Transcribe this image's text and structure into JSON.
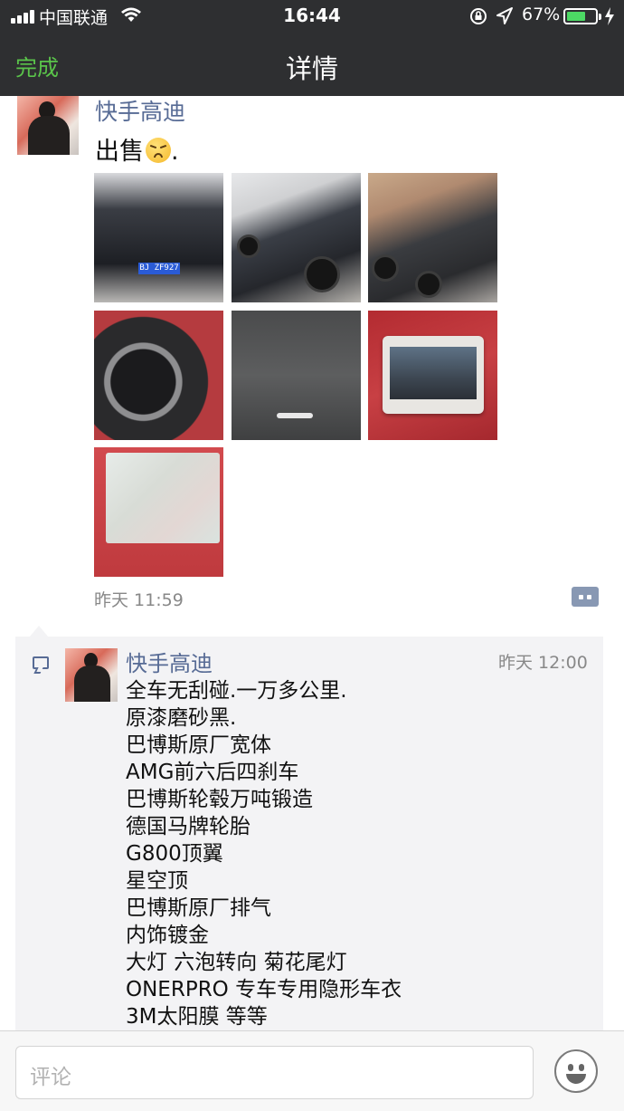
{
  "status_bar": {
    "carrier": "中国联通",
    "time": "16:44",
    "battery_percent": "67%",
    "battery_level": 0.67
  },
  "nav": {
    "done_label": "完成",
    "title": "详情"
  },
  "post": {
    "author": "快手高迪",
    "text": "出售",
    "emoji": "sleepy-face-emoji",
    "text_suffix": ".",
    "photos": [
      "car-front-photo",
      "car-side-photo",
      "car-rear-side-photo",
      "steering-wheel-photo",
      "interior-light-photo",
      "car-photo-card",
      "vehicle-license-photo"
    ],
    "plate": "BJ ZF927",
    "time": "昨天 11:59"
  },
  "comment": {
    "author": "快手高迪",
    "time": "昨天 12:00",
    "lines": [
      "全车无刮碰.一万多公里.",
      "原漆磨砂黑.",
      "巴博斯原厂宽体",
      "AMG前六后四刹车",
      "巴博斯轮毂万吨锻造",
      "德国马牌轮胎",
      "G800顶翼",
      "星空顶",
      "巴博斯原厂排气",
      "内饰镀金",
      "大灯 六泡转向 菊花尾灯",
      "ONERPRO 专车专用隐形车衣",
      "3M太阳膜 等等"
    ]
  },
  "input": {
    "placeholder": "评论"
  },
  "colors": {
    "header_bg": "#2e2f31",
    "accent_green": "#5ac44a",
    "link_blue": "#576b95",
    "comment_bg": "#f3f3f5"
  }
}
